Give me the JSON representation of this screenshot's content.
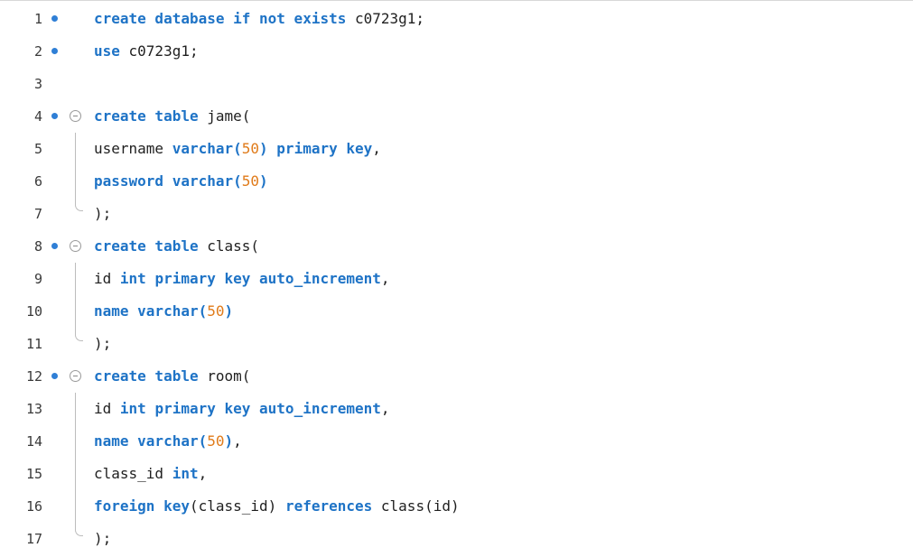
{
  "editor": {
    "lines": [
      {
        "no": "1",
        "dot": true,
        "fold": "none",
        "tokens": [
          {
            "t": "kw",
            "v": "create database if not exists "
          },
          {
            "t": "pl",
            "v": "c0723g1;"
          }
        ]
      },
      {
        "no": "2",
        "dot": true,
        "fold": "none",
        "tokens": [
          {
            "t": "kw",
            "v": "use "
          },
          {
            "t": "pl",
            "v": "c0723g1;"
          }
        ]
      },
      {
        "no": "3",
        "dot": false,
        "fold": "none",
        "tokens": []
      },
      {
        "no": "4",
        "dot": true,
        "fold": "start",
        "tokens": [
          {
            "t": "kw",
            "v": "create table "
          },
          {
            "t": "pl",
            "v": "jame("
          }
        ]
      },
      {
        "no": "5",
        "dot": false,
        "fold": "guide",
        "tokens": [
          {
            "t": "pl",
            "v": "username "
          },
          {
            "t": "kw",
            "v": "varchar("
          },
          {
            "t": "num",
            "v": "50"
          },
          {
            "t": "kw",
            "v": ") primary key"
          },
          {
            "t": "pl",
            "v": ","
          }
        ]
      },
      {
        "no": "6",
        "dot": false,
        "fold": "guide",
        "tokens": [
          {
            "t": "kw",
            "v": "password varchar("
          },
          {
            "t": "num",
            "v": "50"
          },
          {
            "t": "kw",
            "v": ")"
          }
        ]
      },
      {
        "no": "7",
        "dot": false,
        "fold": "end",
        "tokens": [
          {
            "t": "pl",
            "v": ");"
          }
        ]
      },
      {
        "no": "8",
        "dot": true,
        "fold": "start",
        "tokens": [
          {
            "t": "kw",
            "v": "create table "
          },
          {
            "t": "pl",
            "v": "class("
          }
        ]
      },
      {
        "no": "9",
        "dot": false,
        "fold": "guide",
        "tokens": [
          {
            "t": "pl",
            "v": "id "
          },
          {
            "t": "kw",
            "v": "int primary key auto_increment"
          },
          {
            "t": "pl",
            "v": ","
          }
        ]
      },
      {
        "no": "10",
        "dot": false,
        "fold": "guide",
        "tokens": [
          {
            "t": "kw",
            "v": "name varchar("
          },
          {
            "t": "num",
            "v": "50"
          },
          {
            "t": "kw",
            "v": ")"
          }
        ]
      },
      {
        "no": "11",
        "dot": false,
        "fold": "end",
        "tokens": [
          {
            "t": "pl",
            "v": ");"
          }
        ]
      },
      {
        "no": "12",
        "dot": true,
        "fold": "start",
        "tokens": [
          {
            "t": "kw",
            "v": "create table "
          },
          {
            "t": "pl",
            "v": "room("
          }
        ]
      },
      {
        "no": "13",
        "dot": false,
        "fold": "guide",
        "tokens": [
          {
            "t": "pl",
            "v": "id "
          },
          {
            "t": "kw",
            "v": "int primary key auto_increment"
          },
          {
            "t": "pl",
            "v": ","
          }
        ]
      },
      {
        "no": "14",
        "dot": false,
        "fold": "guide",
        "tokens": [
          {
            "t": "kw",
            "v": "name varchar("
          },
          {
            "t": "num",
            "v": "50"
          },
          {
            "t": "kw",
            "v": ")"
          },
          {
            "t": "pl",
            "v": ","
          }
        ]
      },
      {
        "no": "15",
        "dot": false,
        "fold": "guide",
        "tokens": [
          {
            "t": "pl",
            "v": "class_id "
          },
          {
            "t": "kw",
            "v": "int"
          },
          {
            "t": "pl",
            "v": ","
          }
        ]
      },
      {
        "no": "16",
        "dot": false,
        "fold": "guide",
        "tokens": [
          {
            "t": "kw",
            "v": "foreign key"
          },
          {
            "t": "pl",
            "v": "(class_id) "
          },
          {
            "t": "kw",
            "v": "references "
          },
          {
            "t": "pl",
            "v": "class(id)"
          }
        ]
      },
      {
        "no": "17",
        "dot": false,
        "fold": "end",
        "tokens": [
          {
            "t": "pl",
            "v": ");"
          }
        ]
      }
    ]
  },
  "colors": {
    "keyword": "#1e73c6",
    "number": "#e07b1a",
    "text": "#1f1f1f",
    "breakpoint": "#2f7fd6"
  },
  "icons": {
    "statement_marker": "statement-dot-icon",
    "fold_toggle": "fold-collapse-icon"
  }
}
